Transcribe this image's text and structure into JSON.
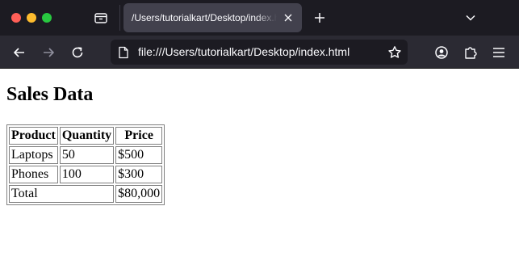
{
  "browser": {
    "tab": {
      "title": "/Users/tutorialkart/Desktop/index.html",
      "close_icon": "close-icon"
    },
    "new_tab_icon": "plus-icon",
    "tab_list_icon": "tab-list-icon",
    "tabs_dropdown_icon": "chevron-down-icon",
    "address_bar": {
      "url": "file:///Users/tutorialkart/Desktop/index.html",
      "page_icon": "page-icon",
      "bookmark_icon": "star-icon"
    },
    "nav": {
      "back_icon": "back-arrow-icon",
      "forward_icon": "forward-arrow-icon",
      "reload_icon": "reload-icon",
      "account_icon": "account-icon",
      "extensions_icon": "puzzle-icon",
      "menu_icon": "hamburger-menu-icon"
    },
    "colors": {
      "tabstrip": "#1c1b22",
      "active_tab": "#42414d",
      "toolbar": "#2b2a33",
      "urlbar": "#1c1b22",
      "traffic_close": "#ff5f57",
      "traffic_minimize": "#febc2e",
      "traffic_maximize": "#28c840"
    }
  },
  "page": {
    "title": "Sales Data",
    "table": {
      "headers": [
        "Product",
        "Quantity",
        "Price"
      ],
      "rows": [
        [
          "Laptops",
          "50",
          "$500"
        ],
        [
          "Phones",
          "100",
          "$300"
        ]
      ],
      "total": {
        "label": "Total",
        "value": "$80,000"
      }
    }
  }
}
